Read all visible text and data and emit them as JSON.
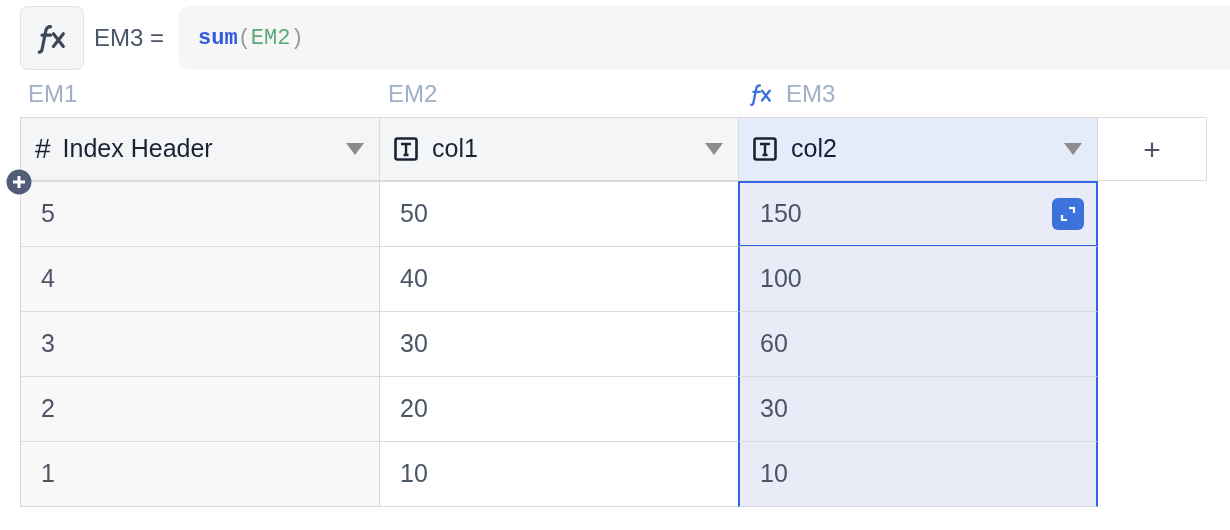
{
  "formula_bar": {
    "target": "EM3 =",
    "tokens": [
      {
        "kind": "function",
        "text": "sum"
      },
      {
        "kind": "punct",
        "text": "("
      },
      {
        "kind": "ref",
        "text": "EM2"
      },
      {
        "kind": "punct",
        "text": ")"
      }
    ]
  },
  "columns": [
    {
      "ref": "EM1",
      "formula": false,
      "kind": "number",
      "symbol": "#",
      "name": "Index Header",
      "selected": false
    },
    {
      "ref": "EM2",
      "formula": false,
      "kind": "text",
      "name": "col1",
      "selected": false
    },
    {
      "ref": "EM3",
      "formula": true,
      "kind": "text",
      "name": "col2",
      "selected": true
    }
  ],
  "add_column": "+",
  "rows": [
    {
      "cells": [
        {
          "text": "5",
          "selected": false
        },
        {
          "text": "50",
          "selected": false
        },
        {
          "text": "150",
          "selected": true
        }
      ]
    },
    {
      "cells": [
        {
          "text": "4",
          "selected": false
        },
        {
          "text": "40",
          "selected": false
        },
        {
          "text": "100",
          "selected": false
        }
      ]
    },
    {
      "cells": [
        {
          "text": "3",
          "selected": false
        },
        {
          "text": "30",
          "selected": false
        },
        {
          "text": "60",
          "selected": false
        }
      ]
    },
    {
      "cells": [
        {
          "text": "2",
          "selected": false
        },
        {
          "text": "20",
          "selected": false
        },
        {
          "text": "30",
          "selected": false
        }
      ]
    },
    {
      "cells": [
        {
          "text": "1",
          "selected": false
        },
        {
          "text": "10",
          "selected": false
        },
        {
          "text": "10",
          "selected": false
        }
      ]
    }
  ]
}
